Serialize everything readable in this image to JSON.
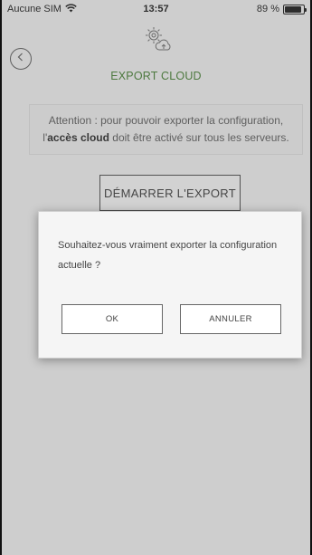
{
  "status_bar": {
    "carrier": "Aucune SIM",
    "time": "13:57",
    "battery_text": "89 %",
    "battery_level": 0.89
  },
  "header": {
    "title": "EXPORT CLOUD",
    "back_icon": "back-chevron-icon",
    "title_icon": "gear-cloud-export-icon",
    "title_color": "#3d7a2a"
  },
  "attention": {
    "prefix": "Attention : pour pouvoir exporter la configuration, l'",
    "bold": "accès cloud",
    "suffix": " doit être activé sur tous les serveurs."
  },
  "export_button": {
    "label": "DÉMARRER L'EXPORT"
  },
  "dialog": {
    "message": "Souhaitez-vous vraiment exporter la configuration actuelle ?",
    "ok_label": "OK",
    "cancel_label": "ANNULER"
  }
}
